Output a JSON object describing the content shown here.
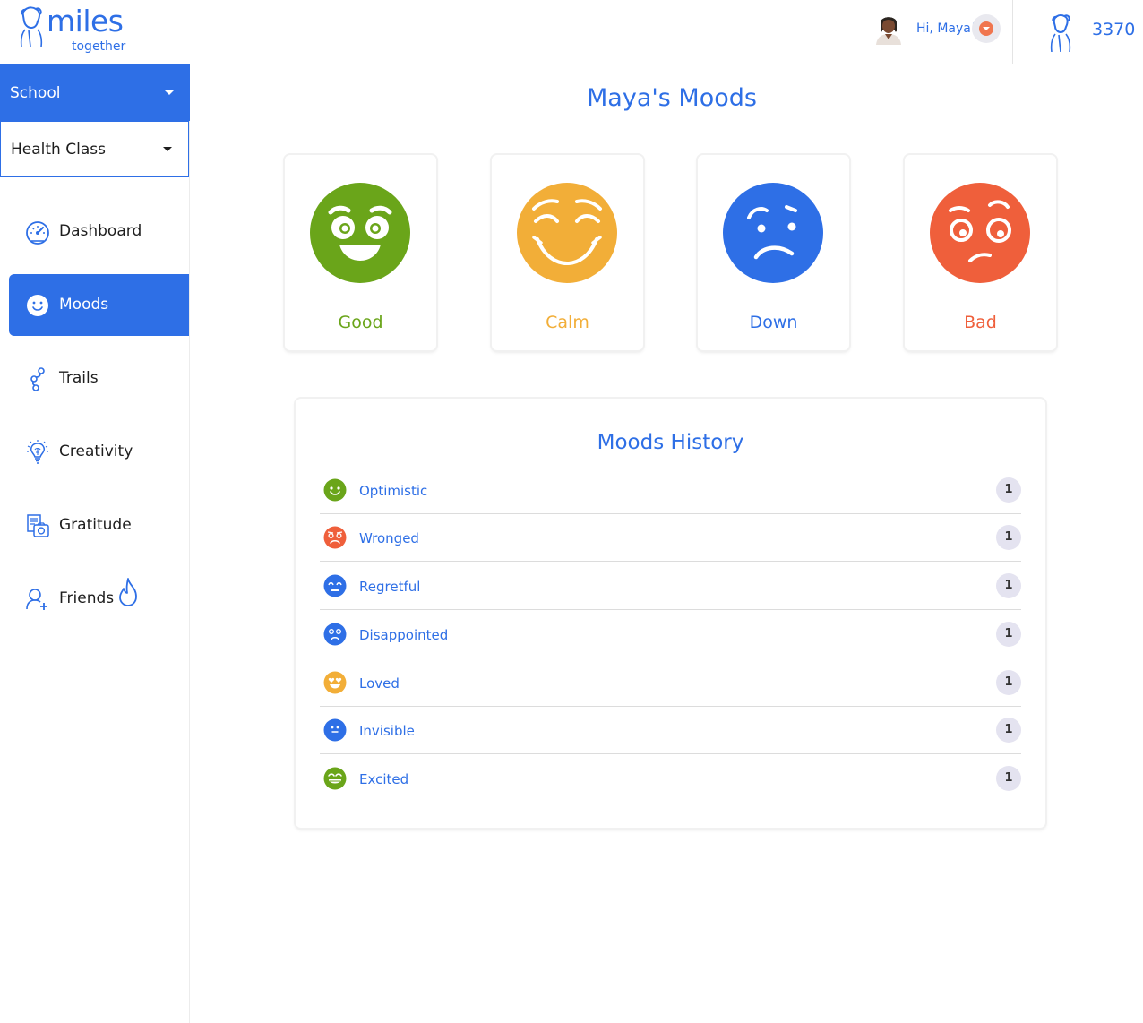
{
  "header": {
    "logo_word": "miles",
    "logo_sub": "together",
    "greeting": "Hi, Maya!",
    "points": "3370"
  },
  "sidebar": {
    "school_select": "School",
    "class_select": "Health Class",
    "items": [
      {
        "label": "Dashboard",
        "icon": "speedometer-icon"
      },
      {
        "label": "Moods",
        "icon": "smiley-icon",
        "active": true
      },
      {
        "label": "Trails",
        "icon": "trail-icon"
      },
      {
        "label": "Creativity",
        "icon": "lightbulb-icon"
      },
      {
        "label": "Gratitude",
        "icon": "photo-journal-icon"
      },
      {
        "label": "Friends",
        "icon": "add-friend-icon"
      }
    ]
  },
  "main": {
    "title": "Maya's Moods",
    "moods": [
      {
        "label": "Good",
        "color": "#6aa51a"
      },
      {
        "label": "Calm",
        "color": "#f2ae38"
      },
      {
        "label": "Down",
        "color": "#2e6fe6"
      },
      {
        "label": "Bad",
        "color": "#ef5f3b"
      }
    ],
    "history": {
      "title": "Moods History",
      "rows": [
        {
          "label": "Optimistic",
          "count": "1",
          "color": "#6aa51a"
        },
        {
          "label": "Wronged",
          "count": "1",
          "color": "#ef5f3b"
        },
        {
          "label": "Regretful",
          "count": "1",
          "color": "#2e6fe6"
        },
        {
          "label": "Disappointed",
          "count": "1",
          "color": "#2e6fe6"
        },
        {
          "label": "Loved",
          "count": "1",
          "color": "#f2ae38"
        },
        {
          "label": "Invisible",
          "count": "1",
          "color": "#2e6fe6"
        },
        {
          "label": "Excited",
          "count": "1",
          "color": "#6aa51a"
        }
      ]
    }
  }
}
